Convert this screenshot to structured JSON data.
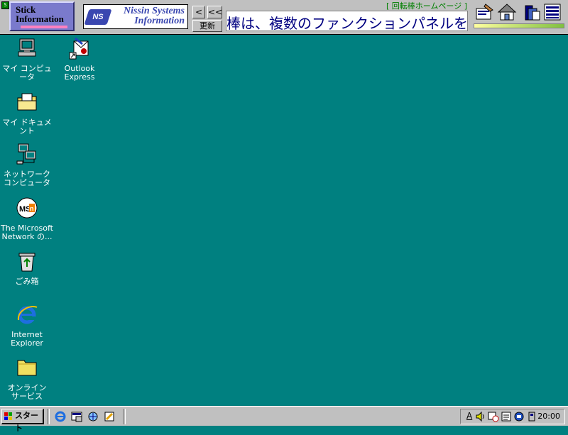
{
  "stickbar": {
    "corner_glyph": "S",
    "logo_line1": "Stick",
    "logo_line2": "Information",
    "banner_badge": "NS",
    "banner_line1": "Nissin Systems",
    "banner_line2": "Information",
    "back_label": "<",
    "back2_label": "<<",
    "refresh_label": "更新",
    "home_link": "[ 回転棒ホームページ ]",
    "ticker_text": "棒は、複数のファンクションパネルを持",
    "tool_icons": [
      "memo-icon",
      "home-icon",
      "book-icon",
      "list-menu-icon"
    ]
  },
  "desktop": {
    "icons": [
      {
        "name": "my-computer",
        "label1": "マイ コンピュータ",
        "label2": ""
      },
      {
        "name": "outlook-express",
        "label1": "Outlook",
        "label2": "Express"
      },
      {
        "name": "my-documents",
        "label1": "マイ ドキュメント",
        "label2": ""
      },
      {
        "name": "network-computer",
        "label1": "ネットワーク",
        "label2": "コンピュータ"
      },
      {
        "name": "msn",
        "label1": "The Microsoft",
        "label2": "Network の..."
      },
      {
        "name": "recycle-bin",
        "label1": "ごみ箱",
        "label2": ""
      },
      {
        "name": "internet-explorer",
        "label1": "Internet",
        "label2": "Explorer"
      },
      {
        "name": "online-services",
        "label1": "オンライン",
        "label2": "サービス"
      }
    ]
  },
  "taskbar": {
    "start_label": "スタート",
    "quicklaunch": [
      "ie-icon",
      "show-desktop-icon",
      "outlook-icon",
      "channels-icon"
    ],
    "tray_ime_label": "A",
    "clock": "20:00"
  },
  "colors": {
    "desktop": "#008080",
    "panel": "#c0c0c0",
    "ticker_text": "#000080"
  }
}
